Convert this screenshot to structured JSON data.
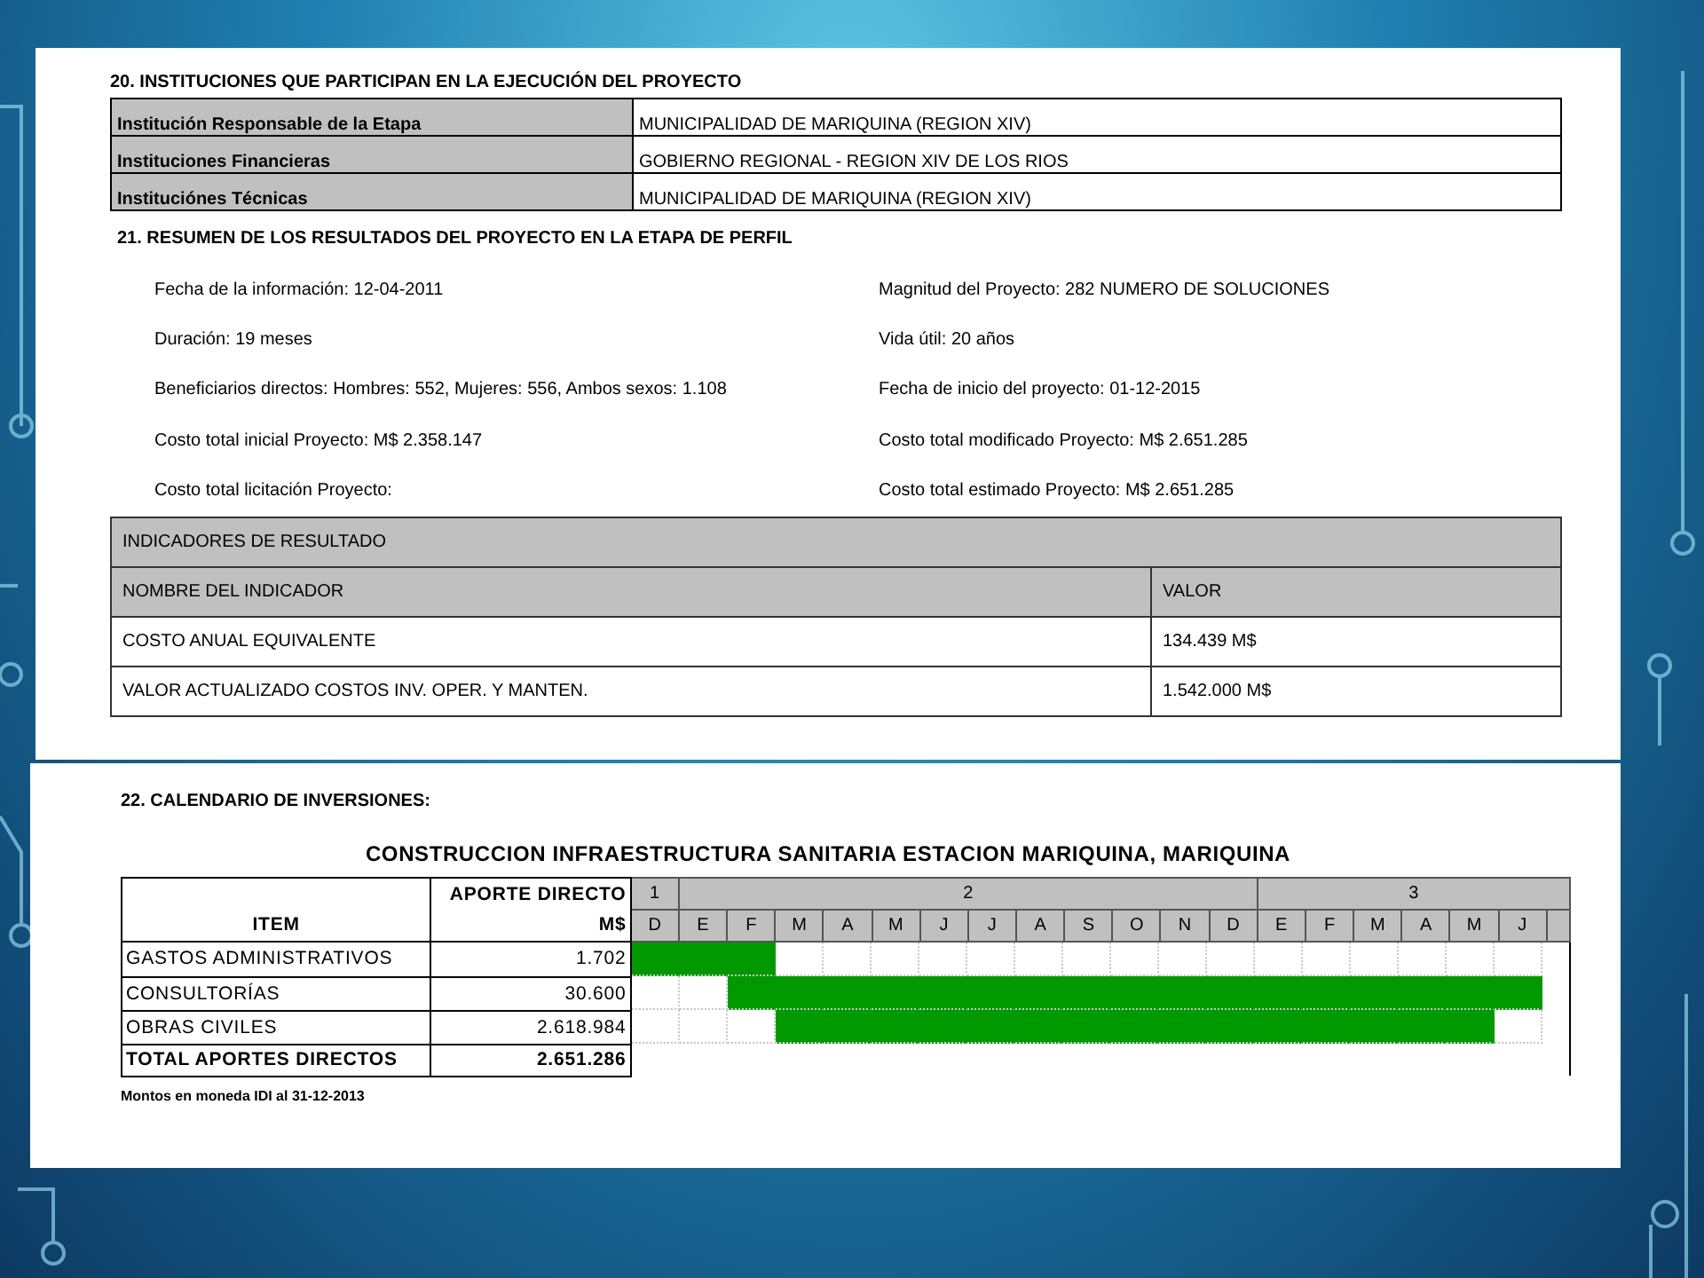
{
  "section_20": {
    "heading": "20. INSTITUCIONES QUE PARTICIPAN EN LA EJECUCIÓN DEL PROYECTO",
    "rows": [
      {
        "label": "Institución Responsable de la Etapa",
        "value": "MUNICIPALIDAD DE MARIQUINA (REGION XIV)"
      },
      {
        "label": "Instituciones Financieras",
        "value": "GOBIERNO REGIONAL - REGION XIV DE LOS RIOS"
      },
      {
        "label": "Instituciónes Técnicas",
        "value": "MUNICIPALIDAD DE MARIQUINA (REGION XIV)"
      }
    ]
  },
  "section_21": {
    "heading": "21. RESUMEN DE LOS RESULTADOS DEL  PROYECTO EN LA ETAPA DE PERFIL",
    "summary": [
      [
        "Fecha de la información: 12-04-2011",
        "Magnitud del Proyecto: 282 NUMERO DE SOLUCIONES"
      ],
      [
        "Duración: 19 meses",
        "Vida útil: 20 años"
      ],
      [
        "Beneficiarios directos: Hombres: 552, Mujeres: 556, Ambos sexos: 1.108",
        "Fecha de inicio del proyecto: 01-12-2015"
      ],
      [
        "Costo total inicial Proyecto: M$ 2.358.147",
        "Costo total modificado Proyecto: M$ 2.651.285"
      ],
      [
        "Costo total licitación Proyecto:",
        "Costo total estimado Proyecto: M$ 2.651.285"
      ]
    ],
    "indicators": {
      "title": "INDICADORES DE RESULTADO",
      "columns": [
        "NOMBRE DEL INDICADOR",
        "VALOR"
      ],
      "rows": [
        [
          "COSTO ANUAL EQUIVALENTE",
          "134.439 M$"
        ],
        [
          "VALOR ACTUALIZADO COSTOS INV. OPER. Y MANTEN.",
          "1.542.000 M$"
        ]
      ]
    }
  },
  "section_22": {
    "heading": "22. CALENDARIO DE INVERSIONES:",
    "gantt": {
      "title": "CONSTRUCCION INFRAESTRUCTURA SANITARIA ESTACION MARIQUINA, MARIQUINA",
      "item_header": "ITEM",
      "amount_header": [
        "APORTE DIRECTO",
        "M$"
      ],
      "years": [
        {
          "label": "1",
          "months": [
            "D"
          ]
        },
        {
          "label": "2",
          "months": [
            "E",
            "F",
            "M",
            "A",
            "M",
            "J",
            "J",
            "A",
            "S",
            "O",
            "N",
            "D"
          ]
        },
        {
          "label": "3",
          "months": [
            "E",
            "F",
            "M",
            "A",
            "M",
            "J"
          ]
        }
      ],
      "rows": [
        {
          "item": "GASTOS ADMINISTRATIVOS",
          "amount": "1.702",
          "filled": [
            true,
            true,
            true,
            false,
            false,
            false,
            false,
            false,
            false,
            false,
            false,
            false,
            false,
            false,
            false,
            false,
            false,
            false,
            false
          ]
        },
        {
          "item": "CONSULTORÍAS",
          "amount": "30.600",
          "filled": [
            false,
            false,
            true,
            true,
            true,
            true,
            true,
            true,
            true,
            true,
            true,
            true,
            true,
            true,
            true,
            true,
            true,
            true,
            true
          ]
        },
        {
          "item": "OBRAS CIVILES",
          "amount": "2.618.984",
          "filled": [
            false,
            false,
            false,
            true,
            true,
            true,
            true,
            true,
            true,
            true,
            true,
            true,
            true,
            true,
            true,
            true,
            true,
            true,
            false
          ]
        }
      ],
      "total": {
        "item": "TOTAL APORTES DIRECTOS",
        "amount": "2.651.286"
      }
    },
    "note": "Montos en moneda IDI al 31-12-2013"
  }
}
